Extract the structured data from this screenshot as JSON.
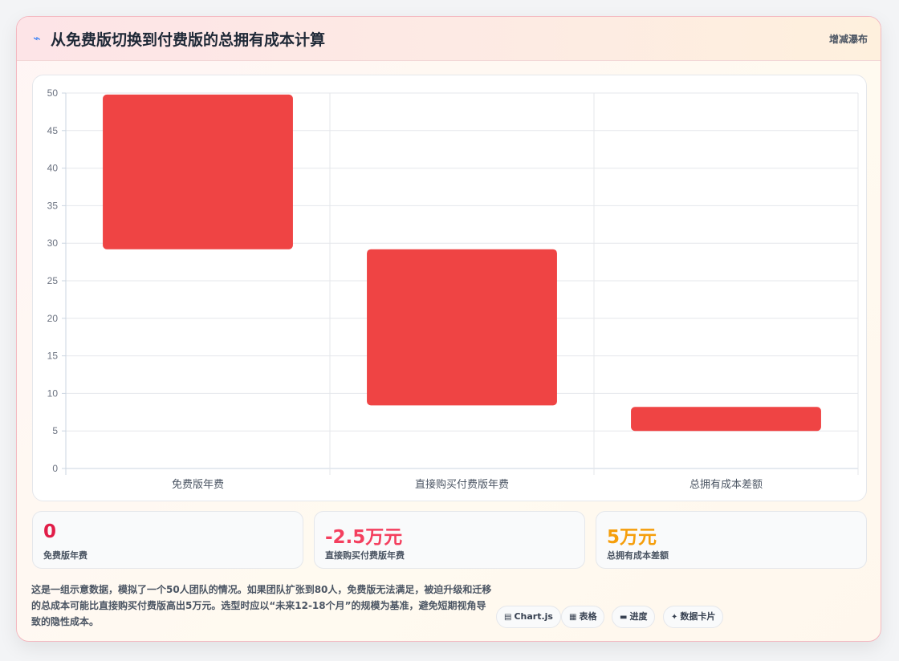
{
  "header": {
    "icon": "lightning-icon",
    "title": "从免费版切换到付费版的总拥有成本计算",
    "chart_type_label": "增减瀑布"
  },
  "colors": {
    "bar": "#ef4444",
    "stat_red": "#e11d48",
    "stat_pink": "#f43f5e",
    "stat_orange": "#f59e0b"
  },
  "chart_data": {
    "type": "bar",
    "subtype": "waterfall",
    "categories": [
      "免费版年费",
      "直接购买付费版年费",
      "总拥有成本差额"
    ],
    "ranges": [
      [
        29.2,
        49.8
      ],
      [
        8.4,
        29.2
      ],
      [
        5.0,
        8.2
      ]
    ],
    "ylim": [
      0,
      50
    ],
    "yticks": [
      0,
      5,
      10,
      15,
      20,
      25,
      30,
      35,
      40,
      45,
      50
    ],
    "grid": true,
    "legend": "none",
    "title": "",
    "xlabel": "",
    "ylabel": ""
  },
  "stats": [
    {
      "value": "0",
      "label": "免费版年费"
    },
    {
      "value": "-2.5万元",
      "label": "直接购买付费版年费"
    },
    {
      "value": "5万元",
      "label": "总拥有成本差额"
    }
  ],
  "note": "这是一组示意数据，模拟了一个50人团队的情况。如果团队扩张到80人，免费版无法满足，被迫升级和迁移的总成本可能比直接购买付费版高出5万元。选型时应以“未来12-18个月”的规模为基准，避免短期视角导致的隐性成本。",
  "tags": [
    {
      "icon": "chart-icon",
      "label": "Chart.js"
    },
    {
      "icon": "table-icon",
      "label": "表格"
    },
    {
      "icon": "progress-icon",
      "label": "进度"
    },
    {
      "icon": "sparkle-icon",
      "label": "数据卡片"
    }
  ]
}
